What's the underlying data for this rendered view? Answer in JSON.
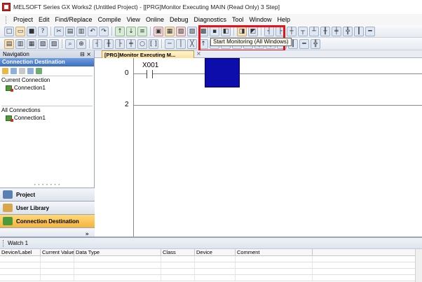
{
  "window": {
    "title": "MELSOFT Series GX Works2 (Untitled Project) - [[PRG]Monitor Executing MAIN (Read Only) 3 Step]"
  },
  "menu": {
    "items": [
      "Project",
      "Edit",
      "Find/Replace",
      "Compile",
      "View",
      "Online",
      "Debug",
      "Diagnostics",
      "Tool",
      "Window",
      "Help"
    ]
  },
  "toolbar": {
    "tooltip": "Start Monitoring (All Windows)",
    "highlight_color": "#e3141b"
  },
  "navigation": {
    "header": "Navigation",
    "section_title": "Connection Destination",
    "current_connection_label": "Current Connection",
    "current_connection_item": "Connection1",
    "all_connections_label": "All Connections",
    "all_connections_item": "Connection1",
    "buttons": [
      "Project",
      "User Library",
      "Connection Destination"
    ],
    "active_button": "Connection Destination"
  },
  "editor": {
    "tab_label": "[PRG]Monitor Executing M...",
    "rungs": [
      {
        "step": "0",
        "contact": "X001"
      },
      {
        "step": "2"
      }
    ],
    "cursor_color": "#0d0dab"
  },
  "watch": {
    "title": "Watch 1",
    "columns": [
      "Device/Label",
      "Current Value",
      "Data Type",
      "Class",
      "Device",
      "Comment"
    ]
  }
}
